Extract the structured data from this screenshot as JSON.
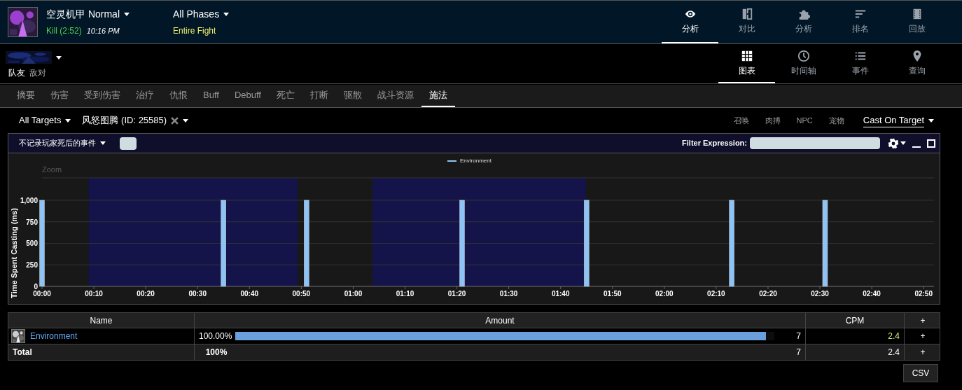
{
  "header": {
    "boss": {
      "name": "空灵机甲 Normal",
      "result": "Kill (2:52)",
      "time": "10:16 PM"
    },
    "phase": {
      "title": "All Phases",
      "subtitle": "Entire Fight"
    },
    "nav": [
      {
        "label": "分析",
        "selected": true
      },
      {
        "label": "对比",
        "selected": false
      },
      {
        "label": "分析",
        "selected": false
      },
      {
        "label": "排名",
        "selected": false
      },
      {
        "label": "回放",
        "selected": false
      }
    ]
  },
  "subnav": {
    "filters": [
      {
        "label": "队友",
        "selected": true
      },
      {
        "label": "敌对",
        "selected": false
      }
    ],
    "views": [
      {
        "label": "图表",
        "selected": true
      },
      {
        "label": "时间轴",
        "selected": false
      },
      {
        "label": "事件",
        "selected": false
      },
      {
        "label": "查询",
        "selected": false
      }
    ]
  },
  "tabs": [
    {
      "label": "摘要",
      "selected": false
    },
    {
      "label": "伤害",
      "selected": false
    },
    {
      "label": "受到伤害",
      "selected": false
    },
    {
      "label": "治疗",
      "selected": false
    },
    {
      "label": "仇恨",
      "selected": false
    },
    {
      "label": "Buff",
      "selected": false
    },
    {
      "label": "Debuff",
      "selected": false
    },
    {
      "label": "死亡",
      "selected": false
    },
    {
      "label": "打断",
      "selected": false
    },
    {
      "label": "驱散",
      "selected": false
    },
    {
      "label": "战斗资源",
      "selected": false
    },
    {
      "label": "施法",
      "selected": true
    }
  ],
  "target_bar": {
    "target": "All Targets",
    "ability": "风怒图腾 (ID: 25585)",
    "options": [
      "召唤",
      "肉搏",
      "NPC",
      "宠物"
    ],
    "mode": "Cast On Target"
  },
  "chart_panel": {
    "death_filter": "不记录玩家死后的事件",
    "toggle": {
      "on": false
    },
    "filter_label": "Filter Expression:",
    "zoom_label": "Zoom",
    "chart_data": {
      "type": "bar",
      "ylabel": "Time Spent Casting (ms)",
      "x": [
        0,
        35,
        51,
        81,
        105,
        133,
        151
      ],
      "series": [
        {
          "name": "Environment",
          "color": "#8ec3f5",
          "values": [
            1000,
            1000,
            1000,
            1000,
            1000,
            1000,
            1000
          ]
        }
      ],
      "xlim": [
        0,
        172
      ],
      "ylim": [
        0,
        1260
      ],
      "grid": true,
      "xticks": [
        {
          "value": 0,
          "label": "00:00"
        },
        {
          "value": 10,
          "label": "00:10"
        },
        {
          "value": 20,
          "label": "00:20"
        },
        {
          "value": 30,
          "label": "00:30"
        },
        {
          "value": 40,
          "label": "00:40"
        },
        {
          "value": 50,
          "label": "00:50"
        },
        {
          "value": 60,
          "label": "01:00"
        },
        {
          "value": 70,
          "label": "01:10"
        },
        {
          "value": 80,
          "label": "01:20"
        },
        {
          "value": 90,
          "label": "01:30"
        },
        {
          "value": 100,
          "label": "01:40"
        },
        {
          "value": 110,
          "label": "01:50"
        },
        {
          "value": 120,
          "label": "02:00"
        },
        {
          "value": 130,
          "label": "02:10"
        },
        {
          "value": 140,
          "label": "02:20"
        },
        {
          "value": 150,
          "label": "02:30"
        },
        {
          "value": 160,
          "label": "02:40"
        },
        {
          "value": 170,
          "label": "02:50"
        }
      ],
      "yticks": [
        0,
        250,
        500,
        750,
        {
          "value": 1000,
          "label": "1,000"
        }
      ],
      "bands": [
        {
          "axis": "x",
          "from": 9,
          "to": 49.3
        },
        {
          "axis": "x",
          "from": 63.7,
          "to": 104.9
        }
      ]
    }
  },
  "table": {
    "columns": [
      "Name",
      "Amount",
      "CPM",
      "+"
    ],
    "rows": [
      {
        "kind": "entry",
        "name": "Environment",
        "percent": "100.00%",
        "level": 1,
        "count": "7",
        "cpm": "2.4",
        "action": "+"
      },
      {
        "kind": "total",
        "name": "Total",
        "percent": "100%",
        "count": "7",
        "cpm": "2.4",
        "action": "+"
      }
    ]
  },
  "csv_button": "CSV"
}
